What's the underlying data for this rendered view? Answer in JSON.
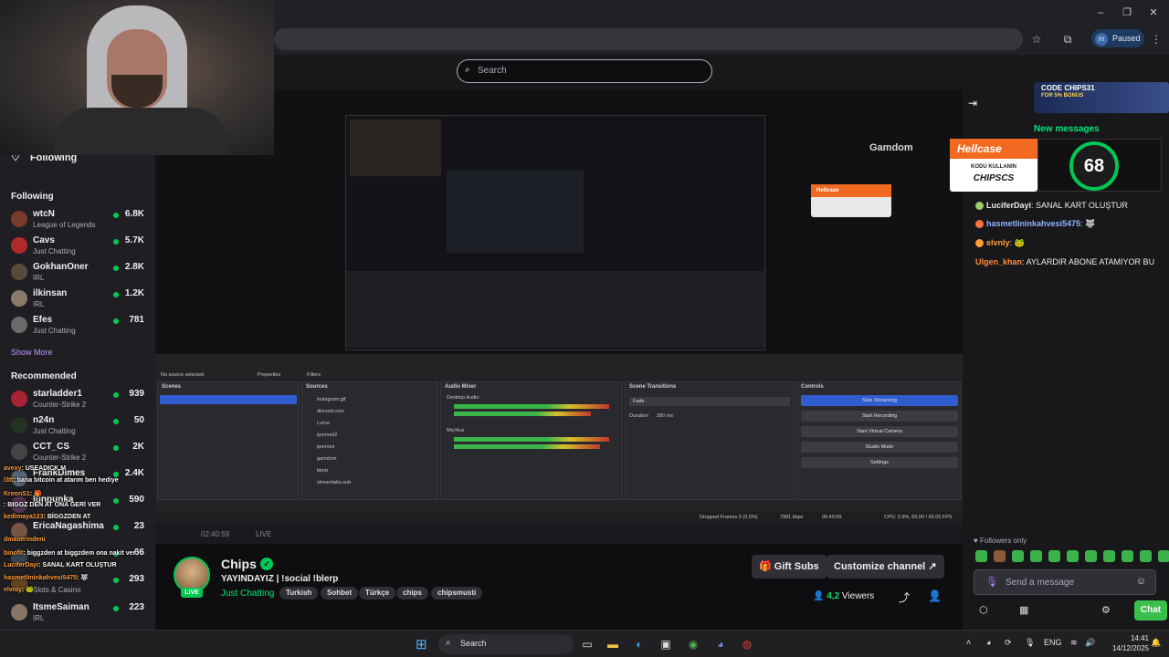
{
  "browser": {
    "profile_initial": "m",
    "profile_status": "Paused",
    "minimize": "–",
    "restore": "❐",
    "close": "✕",
    "icons": [
      "bookmark-star-icon",
      "extensions-icon",
      "menu-kebab-icon"
    ]
  },
  "twitch": {
    "search_placeholder": "Search"
  },
  "sidebar": {
    "following_toggle": "Following",
    "following_header": "Following",
    "following": [
      {
        "name": "wtcN",
        "category": "League of Legends",
        "viewers": "6.8K",
        "color": "#7a3a2a"
      },
      {
        "name": "Cavs",
        "category": "Just Chatting",
        "viewers": "5.7K",
        "color": "#b02a2a"
      },
      {
        "name": "GokhanOner",
        "category": "IRL",
        "viewers": "2.8K",
        "color": "#5a4a3a"
      },
      {
        "name": "ilkinsan",
        "category": "IRL",
        "viewers": "1.2K",
        "color": "#8a7a6a"
      },
      {
        "name": "Efes",
        "category": "Just Chatting",
        "viewers": "781",
        "color": "#6a6a6a"
      }
    ],
    "show_more": "Show More",
    "recommended_header": "Recommended",
    "recommended": [
      {
        "name": "starladder1",
        "category": "Counter-Strike 2",
        "viewers": "939",
        "color": "#aa2233"
      },
      {
        "name": "n24n",
        "category": "Just Chatting",
        "viewers": "50",
        "color": "#223322"
      },
      {
        "name": "CCT_CS",
        "category": "Counter-Strike 2",
        "viewers": "2K",
        "color": "#444444"
      },
      {
        "name": "FrankDimes",
        "category": "",
        "viewers": "2.4K",
        "color": "#556677"
      },
      {
        "name": "lunpunka",
        "category": "",
        "viewers": "590",
        "color": "#553355"
      },
      {
        "name": "EricaNagashima",
        "category": "",
        "viewers": "23",
        "color": "#775544"
      },
      {
        "name": "",
        "category": "",
        "viewers": "66",
        "color": "#334455"
      },
      {
        "name": "",
        "category": "Slots & Casino",
        "viewers": "293",
        "color": "#664422"
      },
      {
        "name": "ItsmeSaiman",
        "category": "IRL",
        "viewers": "223",
        "color": "#887766"
      }
    ]
  },
  "overlay_chat": [
    {
      "user": "avexy",
      "text": ": USEADICK.M"
    },
    {
      "user": "l3tt",
      "text": ": bana bitcoin at atarım ben hediye"
    },
    {
      "user": "KreonS1",
      "text": ": 🎁"
    },
    {
      "user": "",
      "text": ": BIGGZ DEN AT ONA GERİ VER"
    },
    {
      "user": "kedimaya123",
      "text": ": BİGGZDEN AT"
    },
    {
      "user": "",
      "text": ""
    },
    {
      "user": "dmaserindeni",
      "text": ""
    },
    {
      "user": "binofit",
      "text": ": biggzden at biggzdem ona nakit ver"
    },
    {
      "user": "LuciferDayi",
      "text": ": SANAL KART OLUŞTUR"
    },
    {
      "user": "hasmetlininkahvesi5475",
      "text": ": 🐺"
    },
    {
      "user": "elvnly",
      "text": ": 🐸"
    }
  ],
  "video": {
    "gamdom_label": "Gamdom",
    "hellcase_label": "Hellcase",
    "obs": {
      "status": "No source selected",
      "properties": "Properties",
      "filters": "Filters",
      "scenes_title": "Scenes",
      "sources_title": "Sources",
      "mixer_title": "Audio Mixer",
      "transitions_title": "Scene Transitions",
      "controls_title": "Controls",
      "sources": [
        "instagram.gif",
        "discord.com",
        "Luma",
        "ipomoni2",
        "ipomoni",
        "gamdom",
        "blerp",
        "streamlabs.sub"
      ],
      "mixer_desktop": "Desktop Audio",
      "mixer_mic": "Mic/Aux",
      "transition": "Fade",
      "duration_label": "Duration",
      "duration_value": "300 ms",
      "buttons": [
        "Stop Streaming",
        "Start Recording",
        "Start Virtual Camera",
        "Studio Mode",
        "Settings"
      ],
      "stats": "Dropped Frames 0 (0.0%)",
      "bitrate": "7981 kbps",
      "time": "00:40:59",
      "cpu": "CPU: 3.3%, 60.00 / 60.00 FPS",
      "live_label": "LIVE",
      "inner_time": "02:40:59"
    }
  },
  "stream": {
    "name": "Chips",
    "verified": "✓",
    "live": "LIVE",
    "title": "YAYINDAYIZ | !social !blerp",
    "category": "Just Chatting",
    "tags": [
      "Turkish",
      "Sohbet",
      "Türkçe",
      "chips",
      "chipsmusti"
    ],
    "gift_subs": "Gift Subs",
    "customize": "Customize channel",
    "viewers_count": "4,2",
    "viewers_label": "Viewers"
  },
  "chat": {
    "new_messages": "New messages",
    "promo_code": "CODE CHIPS31",
    "promo_bonus": "FOR 5% BONUS",
    "hellcase_title": "Hellcase",
    "hellcase_sub": "KODU KULLANIN",
    "hellcase_code": "CHIPSCS",
    "counter": "68",
    "messages": [
      {
        "user": "LuciferDayi",
        "text": "SANAL KART OLUŞTUR",
        "color": "#e8e8e8"
      },
      {
        "user": "hasmetlininkahvesi5475",
        "text": "🐺",
        "color": "#8fb4ff"
      },
      {
        "user": "elvnly",
        "text": "🐸",
        "color": "#ff9d3a"
      },
      {
        "user": "Ulgen_khan",
        "text": "AYLARDIR ABONE ATAMIYOR BU",
        "color": "#ff8c3a"
      }
    ],
    "followers_only": "Followers only",
    "input_placeholder": "Send a message",
    "send_label": "Chat"
  },
  "taskbar": {
    "search": "Search",
    "lang": "ENG",
    "time": "14:41",
    "date": "14/12/2025"
  }
}
